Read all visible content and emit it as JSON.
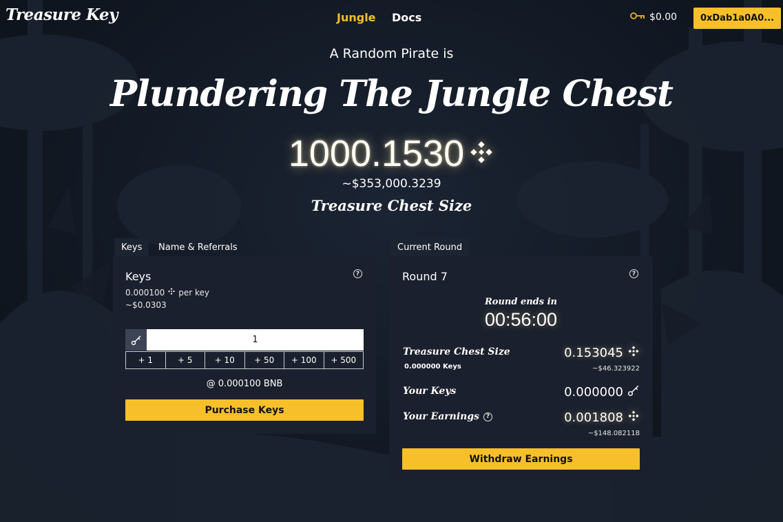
{
  "header": {
    "logo": "Treasure Key",
    "nav": {
      "jungle": "Jungle",
      "docs": "Docs"
    },
    "wallet_balance": "$0.00",
    "address": "0xDab1a0A0..."
  },
  "hero": {
    "subtitle": "A Random Pirate is",
    "headline": "Plundering The Jungle Chest",
    "amount": "1000.1530",
    "usd_value": "~$353,000.3239",
    "chest_label": "Treasure Chest Size"
  },
  "left_panel": {
    "tabs": [
      "Keys",
      "Name & Referrals"
    ],
    "title": "Keys",
    "price_per_key": "0.000100",
    "per_key_label": "per key",
    "price_usd": "~$0.0303",
    "quantity": "1",
    "increments": [
      "+ 1",
      "+ 5",
      "+ 10",
      "+ 50",
      "+ 100",
      "+ 500"
    ],
    "at_price": "@ 0.000100 BNB",
    "purchase_label": "Purchase Keys"
  },
  "right_panel": {
    "tab": "Current Round",
    "title": "Round 7",
    "round_ends_label": "Round ends in",
    "timer": "00:56:00",
    "chest_size_label": "Treasure Chest Size",
    "chest_keys": "0.000000 Keys",
    "chest_size_value": "0.153045",
    "chest_size_usd": "~$46.323922",
    "your_keys_label": "Your Keys",
    "your_keys_value": "0.000000",
    "your_earnings_label": "Your Earnings",
    "your_earnings_value": "0.001808",
    "your_earnings_usd": "~$148.082118",
    "withdraw_label": "Withdraw Earnings"
  },
  "colors": {
    "accent": "#f7c02b",
    "panel": "#1a202d",
    "background": "#121924"
  },
  "icons": [
    "bnb-icon",
    "key-icon",
    "help-icon"
  ]
}
